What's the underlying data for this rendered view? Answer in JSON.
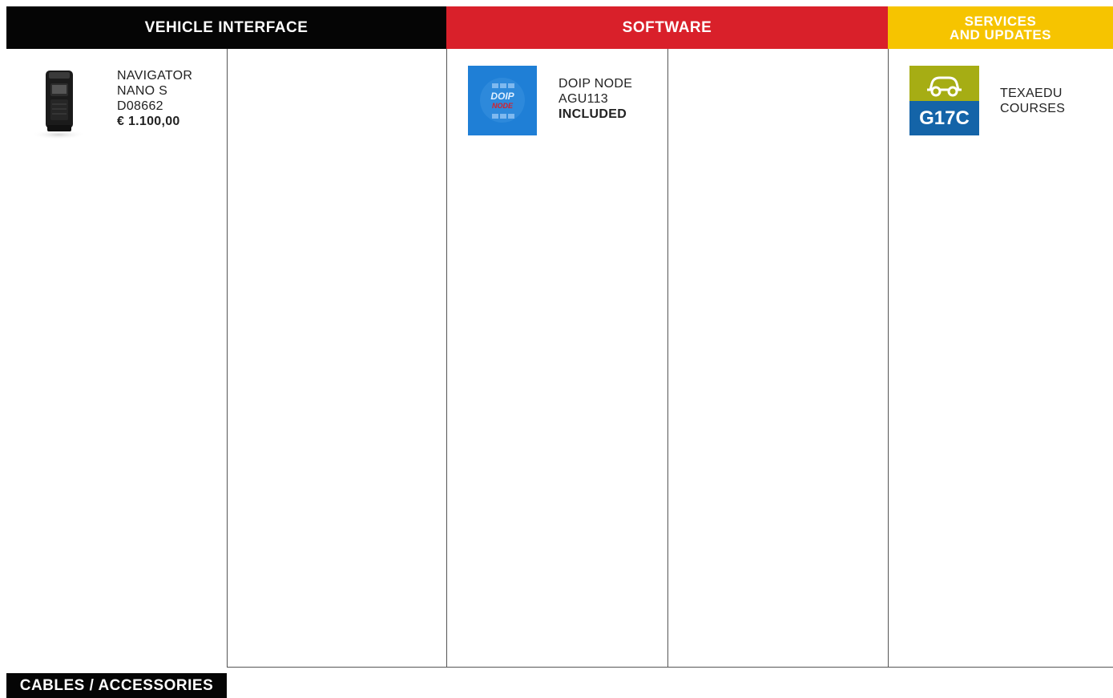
{
  "headers": {
    "vehicle_interface": "VEHICLE INTERFACE",
    "software": "SOFTWARE",
    "services_line1": "SERVICES",
    "services_line2": "AND UPDATES"
  },
  "colors": {
    "vehicle": "#050505",
    "software": "#d9202a",
    "services": "#f6c400",
    "doip_bg": "#1f7fd6",
    "course_top": "#a6ad14",
    "course_bottom": "#1464a8"
  },
  "vehicle": {
    "product_name_1": "NAVIGATOR",
    "product_name_2": "NANO S",
    "code": "D08662",
    "price": "€ 1.100,00",
    "image_icon": "obd-device-image"
  },
  "software": {
    "name": "DOIP NODE",
    "code": "AGU113",
    "status": "INCLUDED",
    "logo_text": "DOIP",
    "image_icon": "doip-node-logo"
  },
  "services": {
    "name_1": "TEXAEDU",
    "name_2": "COURSES",
    "course_code": "G17C",
    "image_icon": "car-course-icon"
  },
  "footer": {
    "cables_label": "CABLES / ACCESSORIES"
  }
}
